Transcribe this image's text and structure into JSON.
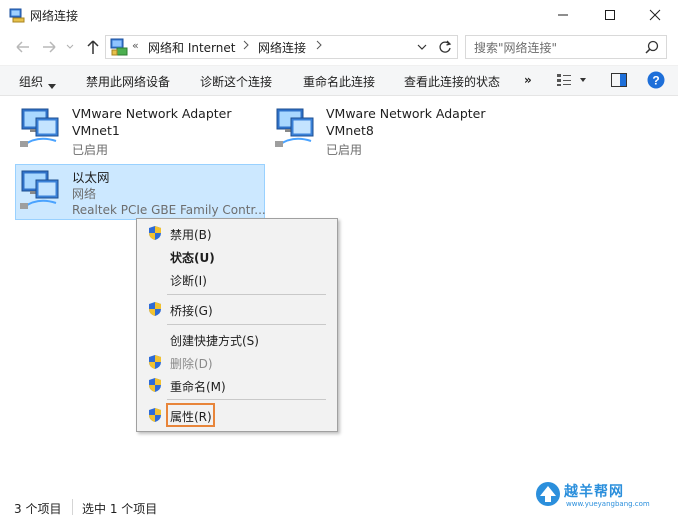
{
  "window": {
    "title": "网络连接"
  },
  "address": {
    "overflow": "«",
    "crumbs": [
      "网络和 Internet",
      "网络连接"
    ]
  },
  "search": {
    "placeholder": "搜索\"网络连接\""
  },
  "toolbar": {
    "organize": "组织",
    "disable": "禁用此网络设备",
    "diagnose": "诊断这个连接",
    "rename": "重命名此连接",
    "view_status": "查看此连接的状态",
    "more": "»"
  },
  "items": [
    {
      "name": "VMware Network Adapter",
      "line2": "VMnet1",
      "status": "已启用"
    },
    {
      "name": "VMware Network Adapter",
      "line2": "VMnet8",
      "status": "已启用"
    },
    {
      "name": "以太网",
      "line2": "网络",
      "status": "Realtek PCIe GBE Family Contr..."
    }
  ],
  "context_menu": {
    "disable": "禁用(B)",
    "status": "状态(U)",
    "diagnose": "诊断(I)",
    "bridge": "桥接(G)",
    "shortcut": "创建快捷方式(S)",
    "delete": "删除(D)",
    "rename": "重命名(M)",
    "properties": "属性(R)"
  },
  "statusbar": {
    "count": "3 个项目",
    "selected": "选中 1 个项目"
  },
  "watermark": {
    "text": "越羊帮网",
    "url": "www.yueyangbang.com"
  },
  "colors": {
    "selection": "#cce8ff",
    "highlight_box": "#e8853a",
    "help": "#1e6fd9"
  }
}
